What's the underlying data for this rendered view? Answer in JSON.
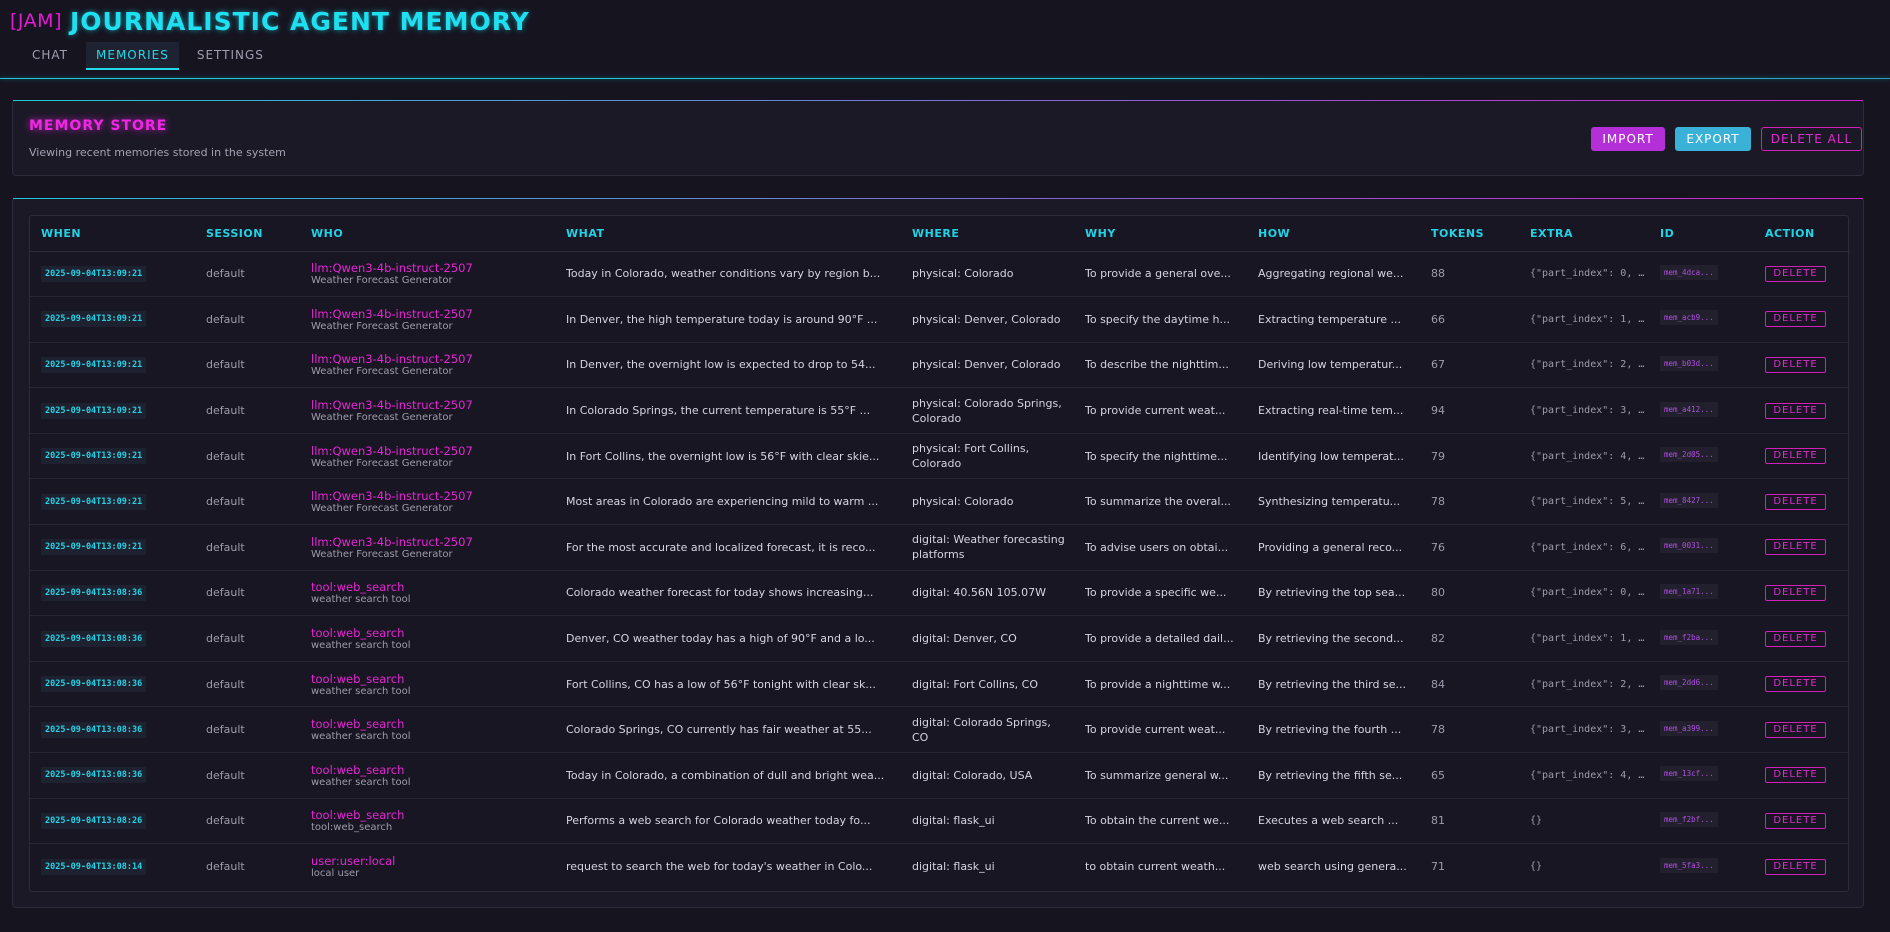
{
  "app": {
    "brand": "[JAM]",
    "title": "JOURNALISTIC AGENT MEMORY"
  },
  "nav": {
    "tabs": [
      {
        "label": "CHAT",
        "active": false
      },
      {
        "label": "MEMORIES",
        "active": true
      },
      {
        "label": "SETTINGS",
        "active": false
      }
    ]
  },
  "store": {
    "title": "MEMORY STORE",
    "subtitle": "Viewing recent memories stored in the system",
    "import_label": "IMPORT",
    "export_label": "EXPORT",
    "delete_all_label": "DELETE ALL"
  },
  "table": {
    "columns": [
      "WHEN",
      "SESSION",
      "WHO",
      "WHAT",
      "WHERE",
      "WHY",
      "HOW",
      "TOKENS",
      "EXTRA",
      "ID",
      "ACTION"
    ],
    "delete_label": "DELETE",
    "rows": [
      {
        "when": "2025-09-04T13:09:21",
        "session": "default",
        "who": "llm:Qwen3-4b-instruct-2507",
        "who_sub": "Weather Forecast Generator",
        "what": "Today in Colorado, weather conditions vary by region b...",
        "where": "physical: Colorado",
        "why": "To provide a general ove...",
        "how": "Aggregating regional we...",
        "tokens": "88",
        "extra": "{\"part_index\": 0, \"t...",
        "id": "mem_4dca..."
      },
      {
        "when": "2025-09-04T13:09:21",
        "session": "default",
        "who": "llm:Qwen3-4b-instruct-2507",
        "who_sub": "Weather Forecast Generator",
        "what": "In Denver, the high temperature today is around 90°F ...",
        "where": "physical: Denver, Colorado",
        "why": "To specify the daytime h...",
        "how": "Extracting temperature ...",
        "tokens": "66",
        "extra": "{\"part_index\": 1, \"t...",
        "id": "mem_acb9..."
      },
      {
        "when": "2025-09-04T13:09:21",
        "session": "default",
        "who": "llm:Qwen3-4b-instruct-2507",
        "who_sub": "Weather Forecast Generator",
        "what": "In Denver, the overnight low is expected to drop to 54...",
        "where": "physical: Denver, Colorado",
        "why": "To describe the nighttim...",
        "how": "Deriving low temperatur...",
        "tokens": "67",
        "extra": "{\"part_index\": 2, \"t...",
        "id": "mem_b03d..."
      },
      {
        "when": "2025-09-04T13:09:21",
        "session": "default",
        "who": "llm:Qwen3-4b-instruct-2507",
        "who_sub": "Weather Forecast Generator",
        "what": "In Colorado Springs, the current temperature is 55°F ...",
        "where": "physical: Colorado Springs, Colorado",
        "why": "To provide current weat...",
        "how": "Extracting real-time tem...",
        "tokens": "94",
        "extra": "{\"part_index\": 3, \"t...",
        "id": "mem_a412..."
      },
      {
        "when": "2025-09-04T13:09:21",
        "session": "default",
        "who": "llm:Qwen3-4b-instruct-2507",
        "who_sub": "Weather Forecast Generator",
        "what": "In Fort Collins, the overnight low is 56°F with clear skie...",
        "where": "physical: Fort Collins, Colorado",
        "why": "To specify the nighttime...",
        "how": "Identifying low temperat...",
        "tokens": "79",
        "extra": "{\"part_index\": 4, \"t...",
        "id": "mem_2d05..."
      },
      {
        "when": "2025-09-04T13:09:21",
        "session": "default",
        "who": "llm:Qwen3-4b-instruct-2507",
        "who_sub": "Weather Forecast Generator",
        "what": "Most areas in Colorado are experiencing mild to warm ...",
        "where": "physical: Colorado",
        "why": "To summarize the overal...",
        "how": "Synthesizing temperatu...",
        "tokens": "78",
        "extra": "{\"part_index\": 5, \"t...",
        "id": "mem_8427..."
      },
      {
        "when": "2025-09-04T13:09:21",
        "session": "default",
        "who": "llm:Qwen3-4b-instruct-2507",
        "who_sub": "Weather Forecast Generator",
        "what": "For the most accurate and localized forecast, it is reco...",
        "where": "digital: Weather forecasting platforms",
        "why": "To advise users on obtai...",
        "how": "Providing a general reco...",
        "tokens": "76",
        "extra": "{\"part_index\": 6, \"t...",
        "id": "mem_0031..."
      },
      {
        "when": "2025-09-04T13:08:36",
        "session": "default",
        "who": "tool:web_search",
        "who_sub": "weather search tool",
        "what": "Colorado weather forecast for today shows increasing...",
        "where": "digital: 40.56N 105.07W",
        "why": "To provide a specific we...",
        "how": "By retrieving the top sea...",
        "tokens": "80",
        "extra": "{\"part_index\": 0, \"t...",
        "id": "mem_1a71..."
      },
      {
        "when": "2025-09-04T13:08:36",
        "session": "default",
        "who": "tool:web_search",
        "who_sub": "weather search tool",
        "what": "Denver, CO weather today has a high of 90°F and a lo...",
        "where": "digital: Denver, CO",
        "why": "To provide a detailed dail...",
        "how": "By retrieving the second...",
        "tokens": "82",
        "extra": "{\"part_index\": 1, \"t...",
        "id": "mem_f2ba..."
      },
      {
        "when": "2025-09-04T13:08:36",
        "session": "default",
        "who": "tool:web_search",
        "who_sub": "weather search tool",
        "what": "Fort Collins, CO has a low of 56°F tonight with clear sk...",
        "where": "digital: Fort Collins, CO",
        "why": "To provide a nighttime w...",
        "how": "By retrieving the third se...",
        "tokens": "84",
        "extra": "{\"part_index\": 2, \"t...",
        "id": "mem_2dd6..."
      },
      {
        "when": "2025-09-04T13:08:36",
        "session": "default",
        "who": "tool:web_search",
        "who_sub": "weather search tool",
        "what": "Colorado Springs, CO currently has fair weather at 55...",
        "where": "digital: Colorado Springs, CO",
        "why": "To provide current weat...",
        "how": "By retrieving the fourth ...",
        "tokens": "78",
        "extra": "{\"part_index\": 3, \"t...",
        "id": "mem_a399..."
      },
      {
        "when": "2025-09-04T13:08:36",
        "session": "default",
        "who": "tool:web_search",
        "who_sub": "weather search tool",
        "what": "Today in Colorado, a combination of dull and bright wea...",
        "where": "digital: Colorado, USA",
        "why": "To summarize general w...",
        "how": "By retrieving the fifth se...",
        "tokens": "65",
        "extra": "{\"part_index\": 4, \"t...",
        "id": "mem_13cf..."
      },
      {
        "when": "2025-09-04T13:08:26",
        "session": "default",
        "who": "tool:web_search",
        "who_sub": "tool:web_search",
        "what": "Performs a web search for Colorado weather today fo...",
        "where": "digital: flask_ui",
        "why": "To obtain the current we...",
        "how": "Executes a web search ...",
        "tokens": "81",
        "extra": "{}",
        "id": "mem_f2bf..."
      },
      {
        "when": "2025-09-04T13:08:14",
        "session": "default",
        "who": "user:user:local",
        "who_sub": "local user",
        "what": "request to search the web for today's weather in Colo...",
        "where": "digital: flask_ui",
        "why": "to obtain current weath...",
        "how": "web search using genera...",
        "tokens": "71",
        "extra": "{}",
        "id": "mem_5fa3..."
      }
    ]
  },
  "colors": {
    "background": "#16141f",
    "accent_cyan": "#22d2e6",
    "accent_magenta": "#e726d6",
    "import_button": "#b52fd8",
    "export_button": "#3ab2d8"
  }
}
